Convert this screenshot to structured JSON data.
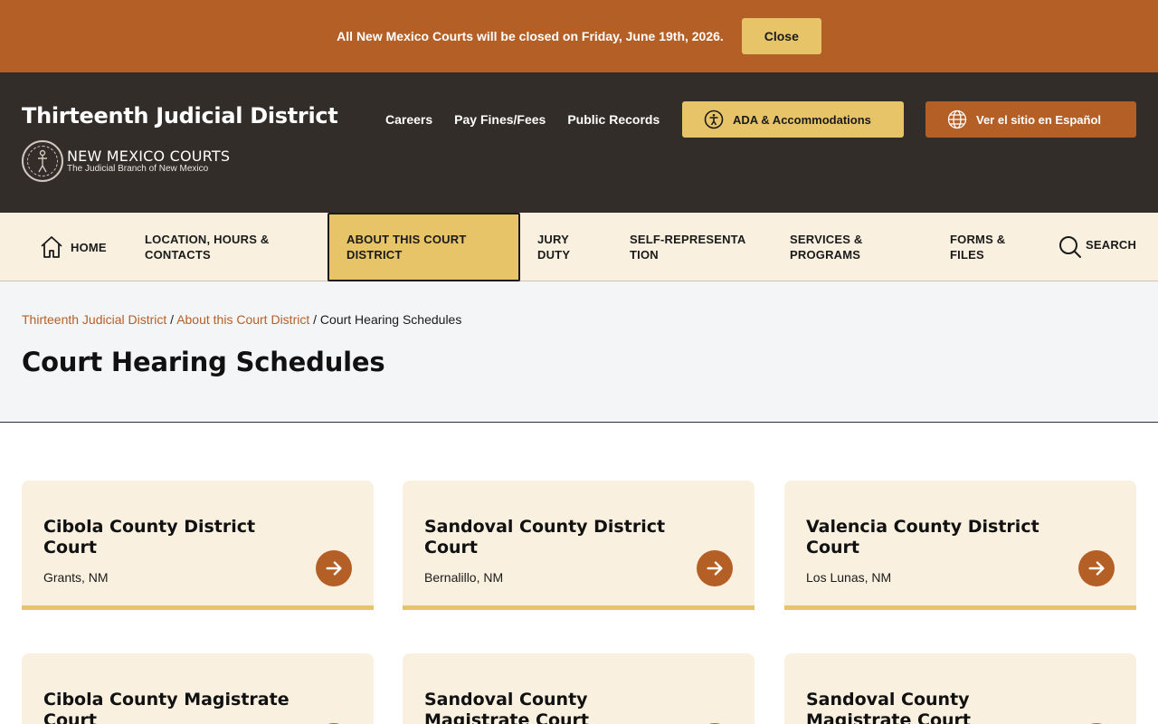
{
  "alert": {
    "message": "All New Mexico Courts will be closed on Friday, June 19th, 2026.",
    "close_label": "Close"
  },
  "header": {
    "site_title": "Thirteenth Judicial District",
    "logo_main": "NEW MEXICO COURTS",
    "logo_sub": "The Judicial Branch of New Mexico",
    "links": [
      "Careers",
      "Pay Fines/Fees",
      "Public Records"
    ],
    "ada_label": "ADA & Accommodations",
    "spanish_label": "Ver el sitio en Español"
  },
  "nav": {
    "home": "HOME",
    "location": "LOCATION, HOURS & CONTACTS",
    "about": "ABOUT THIS COURT DISTRICT",
    "jury": "JURY DUTY",
    "self_rep": "SELF-REPRESENTATION",
    "services": "SERVICES & PROGRAMS",
    "forms": "FORMS & FILES",
    "search": "SEARCH"
  },
  "breadcrumb": {
    "level1": "Thirteenth Judicial District",
    "level2": "About this Court District",
    "current": "Court Hearing Schedules",
    "separator": "/"
  },
  "page_title": "Court Hearing Schedules",
  "cards": [
    {
      "title": "Cibola County District Court",
      "location": "Grants, NM"
    },
    {
      "title": "Sandoval County District Court",
      "location": "Bernalillo, NM"
    },
    {
      "title": "Valencia County District Court",
      "location": "Los Lunas, NM"
    },
    {
      "title": "Cibola County Magistrate Court",
      "location": ""
    },
    {
      "title": "Sandoval County Magistrate Court",
      "location": ""
    },
    {
      "title": "Sandoval County Magistrate Court",
      "location": ""
    }
  ],
  "colors": {
    "brand_orange": "#b45f26",
    "brand_gold": "#e8c468",
    "header_dark": "#322d29",
    "cream": "#f9f0df"
  }
}
